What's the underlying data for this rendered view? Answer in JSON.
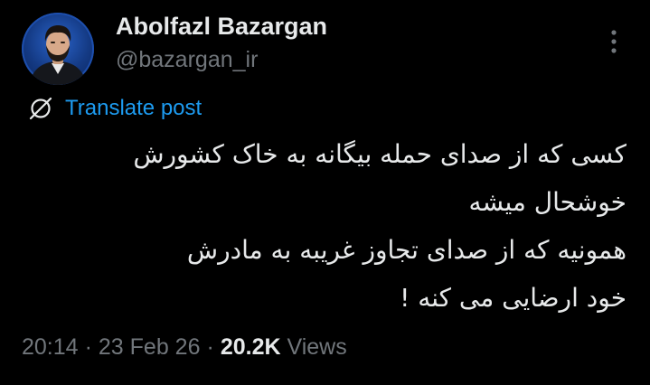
{
  "author": {
    "display_name": "Abolfazl Bazargan",
    "handle": "@bazargan_ir",
    "avatar": "avatar-photo"
  },
  "menu": {
    "icon": "more-vertical-icon"
  },
  "translate": {
    "icon": "globe-slash-icon",
    "label": "Translate post"
  },
  "tweet": {
    "lines": [
      "کسی که از صدای حمله بیگانه به خاک کشورش",
      "خوشحال میشه",
      "همونیه که از صدای تجاوز غریبه به مادرش",
      "خود ارضایی می کنه !"
    ]
  },
  "meta": {
    "time": "20:14",
    "separator": "·",
    "date": "23 Feb 26",
    "views_count": "20.2K",
    "views_label": "Views"
  },
  "colors": {
    "background": "#000000",
    "text": "#e7e9ea",
    "muted": "#71767b",
    "accent": "#1d9bf0",
    "avatar_bg": "#143a84"
  }
}
